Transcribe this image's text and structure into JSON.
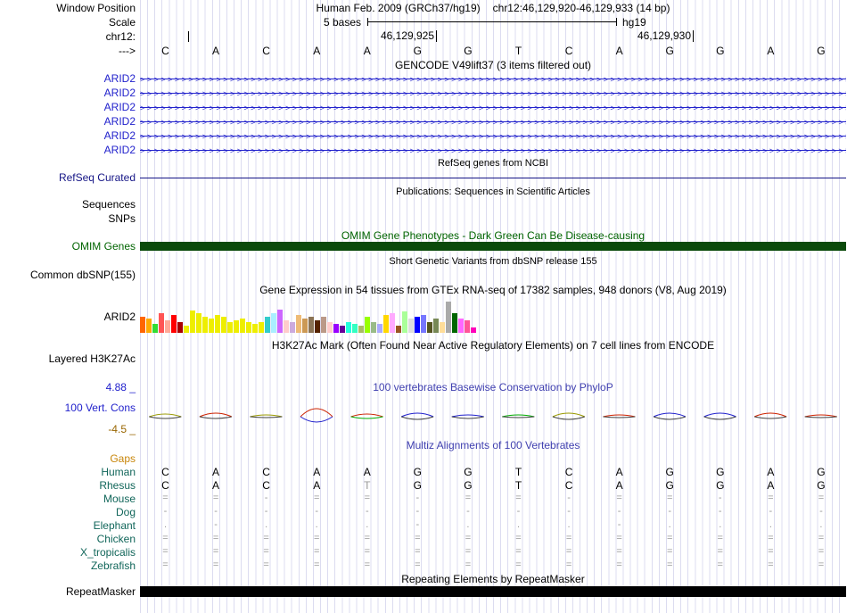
{
  "colors": {
    "track_blue": "#2222cc",
    "title_blue": "#4040b0",
    "refseq_navy": "#151586",
    "dark_green": "#006400",
    "omim_bar_green": "#0b4a0b",
    "gaps_orange": "#c8860a",
    "species_teal": "#11665a",
    "cons_min_brown": "#996600",
    "grid_line": "#dcdcf0",
    "repeat_bar_black": "#000000"
  },
  "header": {
    "window_position_label": "Window Position",
    "assembly": "Human Feb. 2009 (GRCh37/hg19)",
    "position": "chr12:46,129,920-46,129,933 (14 bp)"
  },
  "scale": {
    "label": "Scale",
    "bases_label": "5 bases",
    "assembly_short": "hg19"
  },
  "coords": {
    "label": "chr12:",
    "ticks": [
      "46,129,925",
      "46,129,930"
    ]
  },
  "sequence": {
    "label": "--->",
    "bases": [
      "C",
      "A",
      "C",
      "A",
      "A",
      "G",
      "G",
      "T",
      "C",
      "A",
      "G",
      "G",
      "A",
      "G"
    ]
  },
  "gencode": {
    "title": "GENCODE V49lift37 (3 items filtered out)",
    "arrow_char": ">",
    "genes": [
      "ARID2",
      "ARID2",
      "ARID2",
      "ARID2",
      "ARID2",
      "ARID2"
    ]
  },
  "refseq": {
    "title": "RefSeq genes from NCBI",
    "label": "RefSeq Curated"
  },
  "publications": {
    "title": "Publications: Sequences in Scientific Articles",
    "sequences_label": "Sequences",
    "snps_label": "SNPs"
  },
  "omim": {
    "title": "OMIM Gene Phenotypes - Dark Green Can Be Disease-causing",
    "label": "OMIM Genes"
  },
  "dbsnp": {
    "title": "Short Genetic Variants from dbSNP release 155",
    "label": "Common dbSNP(155)"
  },
  "gtex": {
    "title": "Gene Expression in 54 tissues from GTEx RNA-seq of 17382 samples, 948 donors (V8, Aug 2019)",
    "label": "ARID2"
  },
  "h3k27ac": {
    "title": "H3K27Ac Mark (Often Found Near Active Regulatory Elements) on 7 cell lines from ENCODE",
    "label": "Layered H3K27Ac"
  },
  "conservation": {
    "title": "100 vertebrates Basewise Conservation by PhyloP",
    "label": "100 Vert. Cons",
    "max_label": "4.88 _",
    "min_label": "-4.5 _"
  },
  "multiz": {
    "title": "Multiz Alignments of 100 Vertebrates",
    "rows": [
      {
        "name": "Gaps",
        "kind": "gaps",
        "cells": []
      },
      {
        "name": "Human",
        "kind": "letters",
        "cells": [
          "C",
          "A",
          "C",
          "A",
          "A",
          "G",
          "G",
          "T",
          "C",
          "A",
          "G",
          "G",
          "A",
          "G"
        ]
      },
      {
        "name": "Rhesus",
        "kind": "letters",
        "muted": [
          4
        ],
        "cells": [
          "C",
          "A",
          "C",
          "A",
          "T",
          "G",
          "G",
          "T",
          "C",
          "A",
          "G",
          "G",
          "A",
          "G"
        ]
      },
      {
        "name": "Mouse",
        "kind": "symbols",
        "cells": [
          "=",
          "=",
          "-",
          "=",
          "=",
          "-",
          "=",
          "=",
          "-",
          "=",
          "=",
          "-",
          "=",
          "="
        ]
      },
      {
        "name": "Dog",
        "kind": "symbols",
        "cells": [
          "-",
          "-",
          "-",
          "-",
          "-",
          "-",
          "-",
          "-",
          "-",
          "-",
          "-",
          "-",
          "-",
          "-"
        ]
      },
      {
        "name": "Elephant",
        "kind": "symbols",
        "cells": [
          ".",
          "-",
          ".",
          ".",
          ".",
          "-",
          ".",
          ".",
          ".",
          "-",
          ".",
          ".",
          ".",
          "."
        ]
      },
      {
        "name": "Chicken",
        "kind": "symbols",
        "cells": [
          "=",
          "=",
          "=",
          "=",
          "=",
          "=",
          "=",
          "=",
          "=",
          "=",
          "=",
          "=",
          "=",
          "="
        ]
      },
      {
        "name": "X_tropicalis",
        "kind": "symbols",
        "cells": [
          "=",
          "=",
          "=",
          "=",
          "=",
          "=",
          "=",
          "=",
          "=",
          "=",
          "=",
          "=",
          "=",
          "="
        ]
      },
      {
        "name": "Zebrafish",
        "kind": "symbols",
        "cells": [
          "=",
          "=",
          "=",
          "=",
          "=",
          "=",
          "=",
          "=",
          "=",
          "=",
          "=",
          "=",
          "=",
          "="
        ]
      }
    ]
  },
  "repeatmasker": {
    "title": "Repeating Elements by RepeatMasker",
    "label": "RepeatMasker"
  },
  "chart_data": [
    {
      "type": "bar",
      "title": "Gene Expression in 54 tissues from GTEx RNA-seq of 17382 samples, 948 donors (V8, Aug 2019)",
      "gene": "ARID2",
      "n_tissues": 54,
      "value_axis": "unlabeled (bar heights estimated in px)",
      "values": [
        18,
        16,
        10,
        22,
        14,
        20,
        12,
        8,
        25,
        22,
        18,
        16,
        20,
        18,
        12,
        14,
        16,
        12,
        10,
        12,
        18,
        22,
        26,
        14,
        12,
        20,
        16,
        18,
        14,
        18,
        12,
        10,
        8,
        12,
        10,
        8,
        18,
        12,
        10,
        20,
        22,
        8,
        24,
        16,
        18,
        20,
        12,
        16,
        12,
        35,
        22,
        16,
        14,
        6
      ],
      "colors": [
        "#FF6600",
        "#FFAA00",
        "#33DD33",
        "#FF5555",
        "#FFAA99",
        "#FF0000",
        "#AA0000",
        "#EEEE00",
        "#EEEE00",
        "#EEEE00",
        "#EEEE00",
        "#EEEE00",
        "#EEEE00",
        "#EEEE00",
        "#EEEE00",
        "#EEEE00",
        "#EEEE00",
        "#EEEE00",
        "#EEEE00",
        "#EEEE00",
        "#33CCCC",
        "#AAEEFF",
        "#CC66FF",
        "#FFCCCC",
        "#CCAADD",
        "#EEBB77",
        "#CC9955",
        "#8B7355",
        "#552200",
        "#BB9988",
        "#FFCCCC",
        "#9900FF",
        "#660099",
        "#22FFDD",
        "#33FFC2",
        "#AABB66",
        "#99FF00",
        "#99BB88",
        "#AAAAFF",
        "#FFD700",
        "#FFAAFF",
        "#995522",
        "#AAFF99",
        "#DDDDDD",
        "#0000FF",
        "#7777FF",
        "#555522",
        "#778855",
        "#FFDD99",
        "#AAAAAA",
        "#006600",
        "#FF66FF",
        "#FF5599",
        "#FF00BB"
      ]
    },
    {
      "type": "area",
      "title": "100 vertebrates Basewise Conservation by PhyloP",
      "ylim": [
        -4.5,
        4.88
      ],
      "x_bases": [
        "C",
        "A",
        "C",
        "A",
        "A",
        "G",
        "G",
        "T",
        "C",
        "A",
        "G",
        "G",
        "A",
        "G"
      ],
      "points": [
        {
          "u": 3,
          "d": 2,
          "top": "#999900",
          "bot": "#404040"
        },
        {
          "u": 4,
          "d": 2,
          "top": "#cc2200",
          "bot": "#404040"
        },
        {
          "u": 2,
          "d": 1,
          "top": "#999900",
          "bot": "#404040"
        },
        {
          "u": 9,
          "d": 6,
          "top": "#cc2200",
          "bot": "#2222cc"
        },
        {
          "u": 3,
          "d": 2,
          "top": "#cc2200",
          "bot": "#00aa00"
        },
        {
          "u": 4,
          "d": 3,
          "top": "#2222cc",
          "bot": "#404040"
        },
        {
          "u": 2,
          "d": 2,
          "top": "#2222cc",
          "bot": "#404040"
        },
        {
          "u": 2,
          "d": 1,
          "top": "#00aa00",
          "bot": "#404040"
        },
        {
          "u": 4,
          "d": 3,
          "top": "#999900",
          "bot": "#404040"
        },
        {
          "u": 2,
          "d": 1,
          "top": "#cc2200",
          "bot": "#404040"
        },
        {
          "u": 4,
          "d": 3,
          "top": "#2222cc",
          "bot": "#404040"
        },
        {
          "u": 4,
          "d": 3,
          "top": "#2222cc",
          "bot": "#404040"
        },
        {
          "u": 4,
          "d": 2,
          "top": "#cc2200",
          "bot": "#404040"
        },
        {
          "u": 2,
          "d": 1,
          "top": "#cc2200",
          "bot": "#404040"
        }
      ]
    }
  ]
}
